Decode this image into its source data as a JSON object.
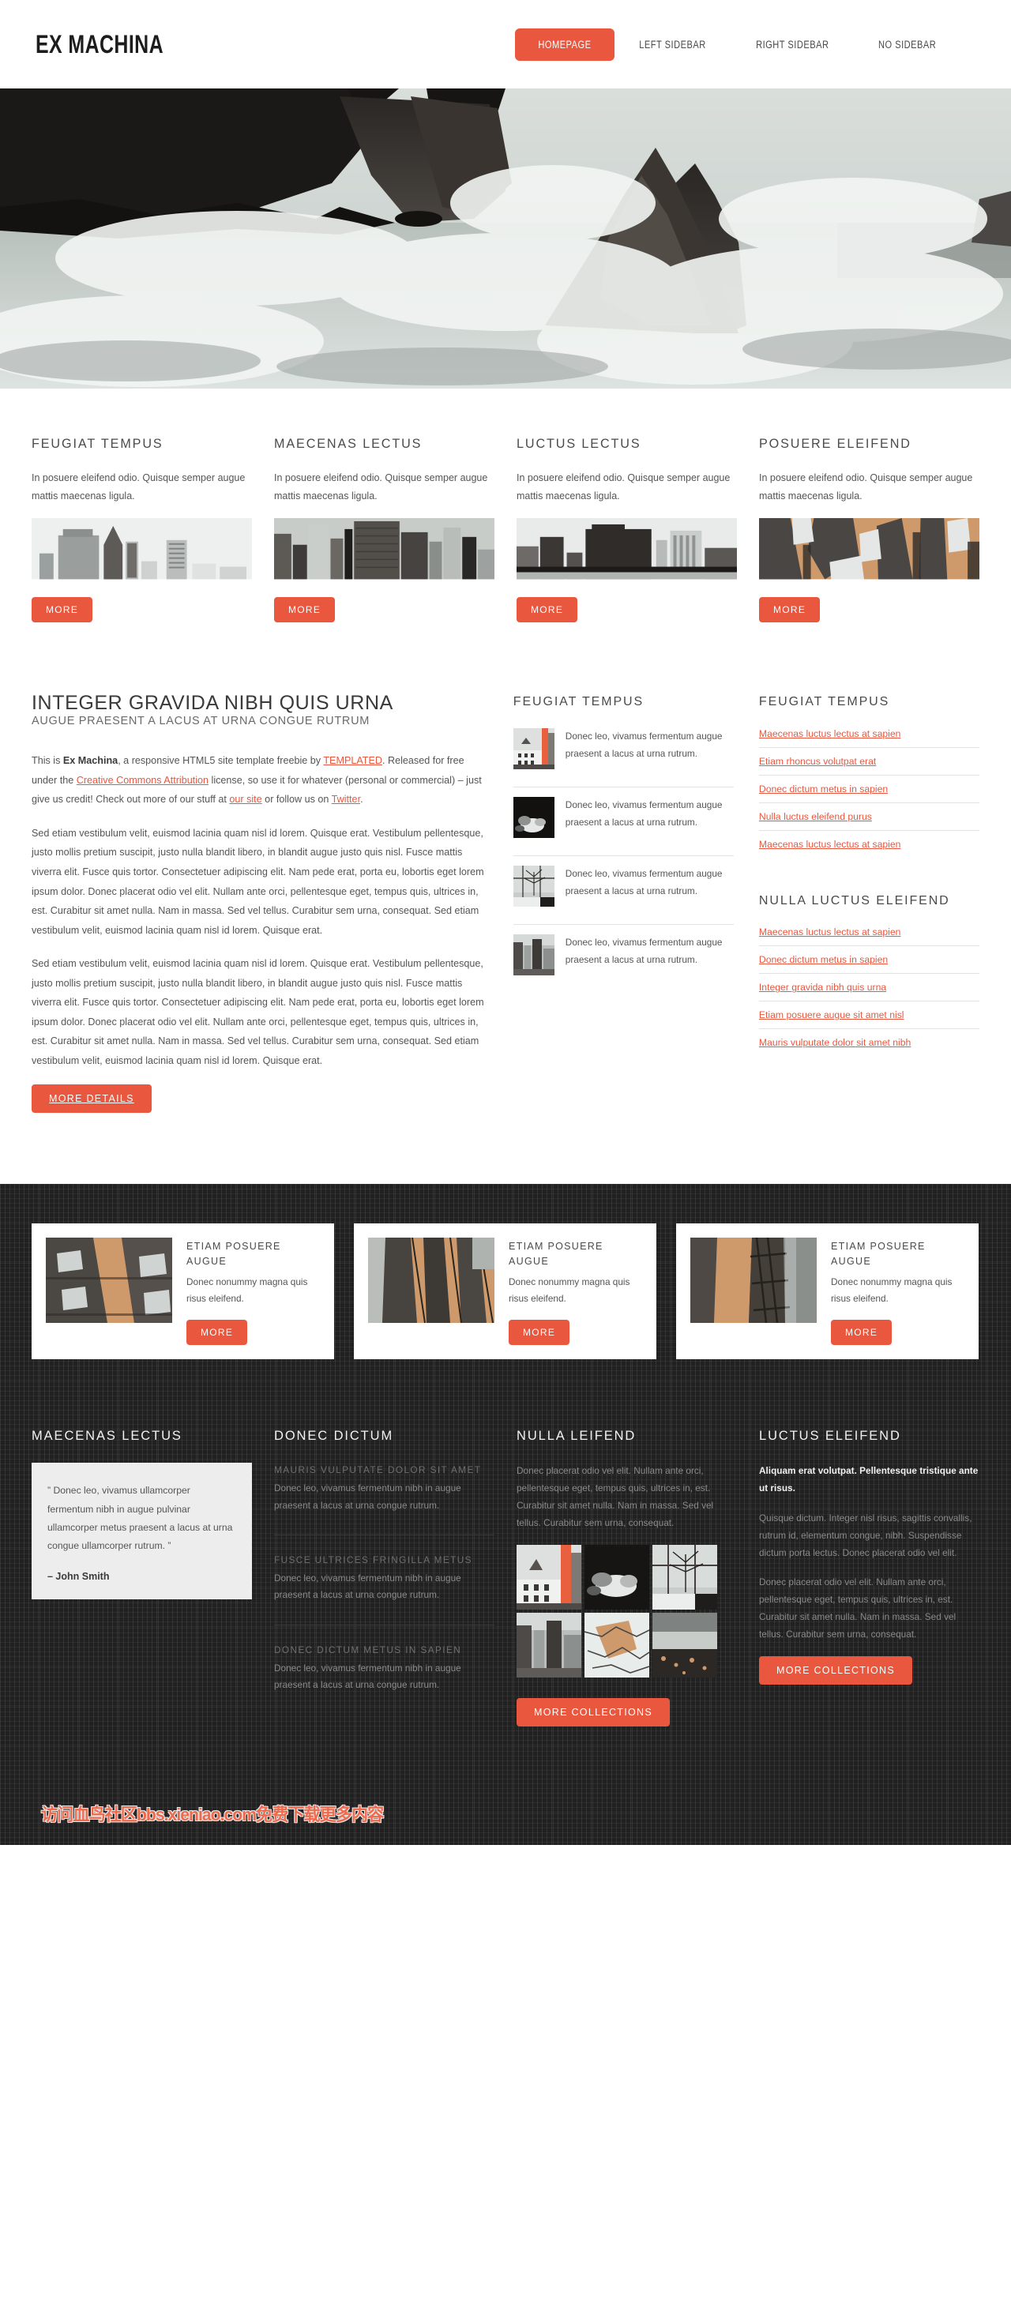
{
  "colors": {
    "accent": "#e9573f",
    "dark": "#212121",
    "text": "#555555",
    "heading": "#3a3a3a"
  },
  "header": {
    "logo": "EX MACHINA",
    "nav": [
      {
        "label": "HOMEPAGE",
        "active": true
      },
      {
        "label": "LEFT SIDEBAR",
        "active": false
      },
      {
        "label": "RIGHT SIDEBAR",
        "active": false
      },
      {
        "label": "NO SIDEBAR",
        "active": false
      }
    ]
  },
  "banner": {
    "alt": "rocky-coastline-waves-photo"
  },
  "features": [
    {
      "title": "FEUGIAT TEMPUS",
      "text": "In posuere eleifend odio. Quisque semper augue mattis maecenas ligula.",
      "button": "MORE",
      "image": "city-skyline-chrysler"
    },
    {
      "title": "MAECENAS LECTUS",
      "text": "In posuere eleifend odio. Quisque semper augue mattis maecenas ligula.",
      "button": "MORE",
      "image": "city-skyscrapers-dense"
    },
    {
      "title": "LUCTUS LECTUS",
      "text": "In posuere eleifend odio. Quisque semper augue mattis maecenas ligula.",
      "button": "MORE",
      "image": "city-waterfront"
    },
    {
      "title": "POSUERE ELEIFEND",
      "text": "In posuere eleifend odio. Quisque semper augue mattis maecenas ligula.",
      "button": "MORE",
      "image": "city-aerial-sepia"
    }
  ],
  "main": {
    "title": "INTEGER GRAVIDA NIBH QUIS URNA",
    "subtitle": "AUGUE PRAESENT A LACUS AT URNA CONGUE RUTRUM",
    "intro": {
      "p1": "This is ",
      "brand": "Ex Machina",
      "p2": ", a responsive HTML5 site template freebie by ",
      "link_templated": "TEMPLATED",
      "p3": ". Released for free under the ",
      "link_cc": "Creative Commons Attribution",
      "p4": " license, so use it for whatever (personal or commercial) – just give us credit! Check out more of our stuff at ",
      "link_site": "our site",
      "p5": " or follow us on ",
      "link_twitter": "Twitter",
      "p6": "."
    },
    "paragraph2": "Sed etiam vestibulum velit, euismod lacinia quam nisl id lorem. Quisque erat. Vestibulum pellentesque, justo mollis pretium suscipit, justo nulla blandit libero, in blandit augue justo quis nisl. Fusce mattis viverra elit. Fusce quis tortor. Consectetuer adipiscing elit. Nam pede erat, porta eu, lobortis eget lorem ipsum dolor. Donec placerat odio vel elit. Nullam ante orci, pellentesque eget, tempus quis, ultrices in, est. Curabitur sit amet nulla. Nam in massa. Sed vel tellus. Curabitur sem urna, consequat. Sed etiam vestibulum velit, euismod lacinia quam nisl id lorem. Quisque erat.",
    "paragraph3": "Sed etiam vestibulum velit, euismod lacinia quam nisl id lorem. Quisque erat. Vestibulum pellentesque, justo mollis pretium suscipit, justo nulla blandit libero, in blandit augue justo quis nisl. Fusce mattis viverra elit. Fusce quis tortor. Consectetuer adipiscing elit. Nam pede erat, porta eu, lobortis eget lorem ipsum dolor. Donec placerat odio vel elit. Nullam ante orci, pellentesque eget, tempus quis, ultrices in, est. Curabitur sit amet nulla. Nam in massa. Sed vel tellus. Curabitur sem urna, consequat. Sed etiam vestibulum velit, euismod lacinia quam nisl id lorem. Quisque erat.",
    "more_details_button": "MORE DETAILS"
  },
  "sidebar1": {
    "title": "FEUGIAT TEMPUS",
    "posts": [
      {
        "text": "Donec leo, vivamus fermentum augue praesent a lacus at urna rutrum.",
        "image": "old-town-buildings"
      },
      {
        "text": "Donec leo, vivamus fermentum augue praesent a lacus at urna rutrum.",
        "image": "dark-smoke-abstract"
      },
      {
        "text": "Donec leo, vivamus fermentum augue praesent a lacus at urna rutrum.",
        "image": "window-tree-branches"
      },
      {
        "text": "Donec leo, vivamus fermentum augue praesent a lacus at urna rutrum.",
        "image": "city-towers-grey"
      }
    ]
  },
  "sidebar2": {
    "title1": "FEUGIAT TEMPUS",
    "links1": [
      "Maecenas luctus lectus at sapien",
      "Etiam rhoncus volutpat erat",
      "Donec dictum metus in sapien",
      "Nulla luctus eleifend purus",
      "Maecenas luctus lectus at sapien"
    ],
    "title2": "NULLA LUCTUS ELEIFEND",
    "links2": [
      "Maecenas luctus lectus at sapien",
      "Donec dictum metus in sapien",
      "Integer gravida nibh quis urna",
      "Etiam posuere augue sit amet nisl",
      "Mauris vulputate dolor sit amet nibh"
    ]
  },
  "promo_cards": [
    {
      "title": "ETIAM POSUERE AUGUE",
      "text": "Donec nonummy magna quis risus eleifend.",
      "button": "MORE",
      "image": "brick-facade-windows"
    },
    {
      "title": "ETIAM POSUERE AUGUE",
      "text": "Donec nonummy magna quis risus eleifend.",
      "button": "MORE",
      "image": "fire-escape-facade"
    },
    {
      "title": "ETIAM POSUERE AUGUE",
      "text": "Donec nonummy magna quis risus eleifend.",
      "button": "MORE",
      "image": "steel-fire-escape"
    }
  ],
  "footer": {
    "col1": {
      "title": "MAECENAS LECTUS",
      "quote": "”  Donec leo, vivamus ullamcorper fermentum nibh in augue pulvinar ullamcorper metus praesent a lacus at urna congue ullamcorper rutrum.  ”",
      "author": "–  John Smith"
    },
    "col2": {
      "title": "DONEC DICTUM",
      "items": [
        {
          "heading": "MAURIS VULPUTATE DOLOR SIT AMET",
          "text": "Donec leo, vivamus fermentum nibh in augue praesent a lacus at urna congue rutrum."
        },
        {
          "heading": "FUSCE ULTRICES FRINGILLA METUS",
          "text": "Donec leo, vivamus fermentum nibh in augue praesent a lacus at urna congue rutrum."
        },
        {
          "heading": "DONEC DICTUM METUS IN SAPIEN",
          "text": "Donec leo, vivamus fermentum nibh in augue praesent a lacus at urna congue rutrum."
        }
      ]
    },
    "col3": {
      "title": "NULLA LEIFEND",
      "text": "Donec placerat odio vel elit. Nullam ante orci, pellentesque eget, tempus quis, ultrices in, est. Curabitur sit amet nulla. Nam in massa. Sed vel tellus. Curabitur sem urna, consequat.",
      "button": "MORE COLLECTIONS",
      "gallery": [
        "old-town-buildings",
        "dark-smoke-abstract",
        "window-tree-branches",
        "city-towers-grey",
        "orange-marble-abstract",
        "landscape-dusk"
      ]
    },
    "col4": {
      "title": "LUCTUS ELEIFEND",
      "lead": "Aliquam erat volutpat. Pellentesque tristique ante ut risus.",
      "text1": "Quisque dictum. Integer nisl risus, sagittis convallis, rutrum id, elementum congue, nibh. Suspendisse dictum porta lectus. Donec placerat odio vel elit.",
      "text2": "Donec placerat odio vel elit. Nullam ante orci, pellentesque eget, tempus quis, ultrices in, est. Curabitur sit amet nulla. Nam in massa. Sed vel tellus. Curabitur sem urna, consequat.",
      "button": "MORE COLLECTIONS"
    }
  },
  "watermark": "访问血鸟社区bbs.xieniao.com免费下载更多内容"
}
